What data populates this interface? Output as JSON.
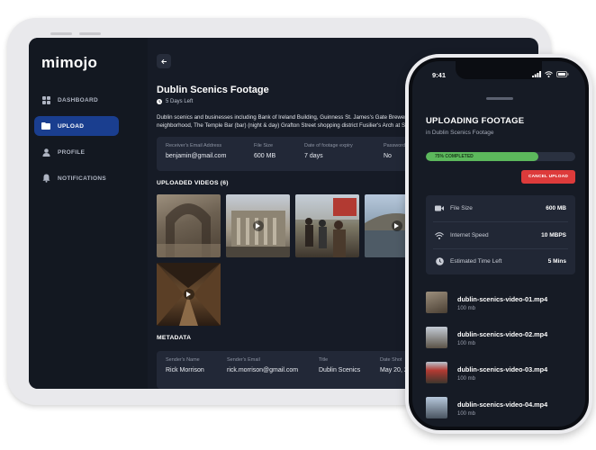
{
  "tablet": {
    "logo": "mimojo",
    "nav": [
      {
        "label": "DASHBOARD",
        "icon": "dashboard-grid-icon",
        "active": false
      },
      {
        "label": "UPLOAD",
        "icon": "folder-icon",
        "active": true
      },
      {
        "label": "PROFILE",
        "icon": "user-icon",
        "active": false
      },
      {
        "label": "NOTIFICATIONS",
        "icon": "bell-icon",
        "active": false
      }
    ],
    "title": "Dublin Scenics Footage",
    "days_left": "5 Days Left",
    "description_line1": "Dublin scenics and businesses including Bank of Ireland Building, Guinness St. James's Gate Brewery",
    "description_line2": "neighborhood, The Temple Bar (bar) (night & day) Grafton Street shopping district Fusilier's Arch at St",
    "info": [
      {
        "label": "Receiver's Email Address",
        "value": "benjamin@gmail.com"
      },
      {
        "label": "File Size",
        "value": "600 MB"
      },
      {
        "label": "Date of footage expiry",
        "value": "7 days"
      },
      {
        "label": "Password",
        "value": "No"
      }
    ],
    "uploaded_heading": "UPLOADED VIDEOS (6)",
    "metadata_heading": "METADATA",
    "metadata": [
      {
        "label": "Sender's Name",
        "value": "Rick Morrison"
      },
      {
        "label": "Sender's Email",
        "value": "rick.morrison@gmail.com"
      },
      {
        "label": "Title",
        "value": "Dublin Scenics"
      },
      {
        "label": "Date Shot",
        "value": "May 20, 2"
      }
    ]
  },
  "phone": {
    "time": "9:41",
    "title": "UPLOADING FOOTAGE",
    "subtitle": "in Dublin Scenics Footage",
    "progress_label": "75% COMPLETED",
    "progress_value": 0.75,
    "cancel_label": "CANCEL UPLOAD",
    "stats": [
      {
        "label": "File Size",
        "value": "600 MB",
        "icon": "video-camera-icon"
      },
      {
        "label": "Internet Speed",
        "value": "10 MBPS",
        "icon": "wifi-icon"
      },
      {
        "label": "Estimated Time Left",
        "value": "5 Mins",
        "icon": "clock-icon"
      }
    ],
    "files": [
      {
        "name": "dublin-scenics-video-01.mp4",
        "size": "100 mb"
      },
      {
        "name": "dublin-scenics-video-02.mp4",
        "size": "100 mb"
      },
      {
        "name": "dublin-scenics-video-03.mp4",
        "size": "100 mb"
      },
      {
        "name": "dublin-scenics-video-04.mp4",
        "size": "100 mb"
      }
    ]
  },
  "colors": {
    "background": "#161b26",
    "accent_blue": "#1a3e8f",
    "progress_green": "#5cb85c",
    "cancel_red": "#dd3b3b"
  }
}
